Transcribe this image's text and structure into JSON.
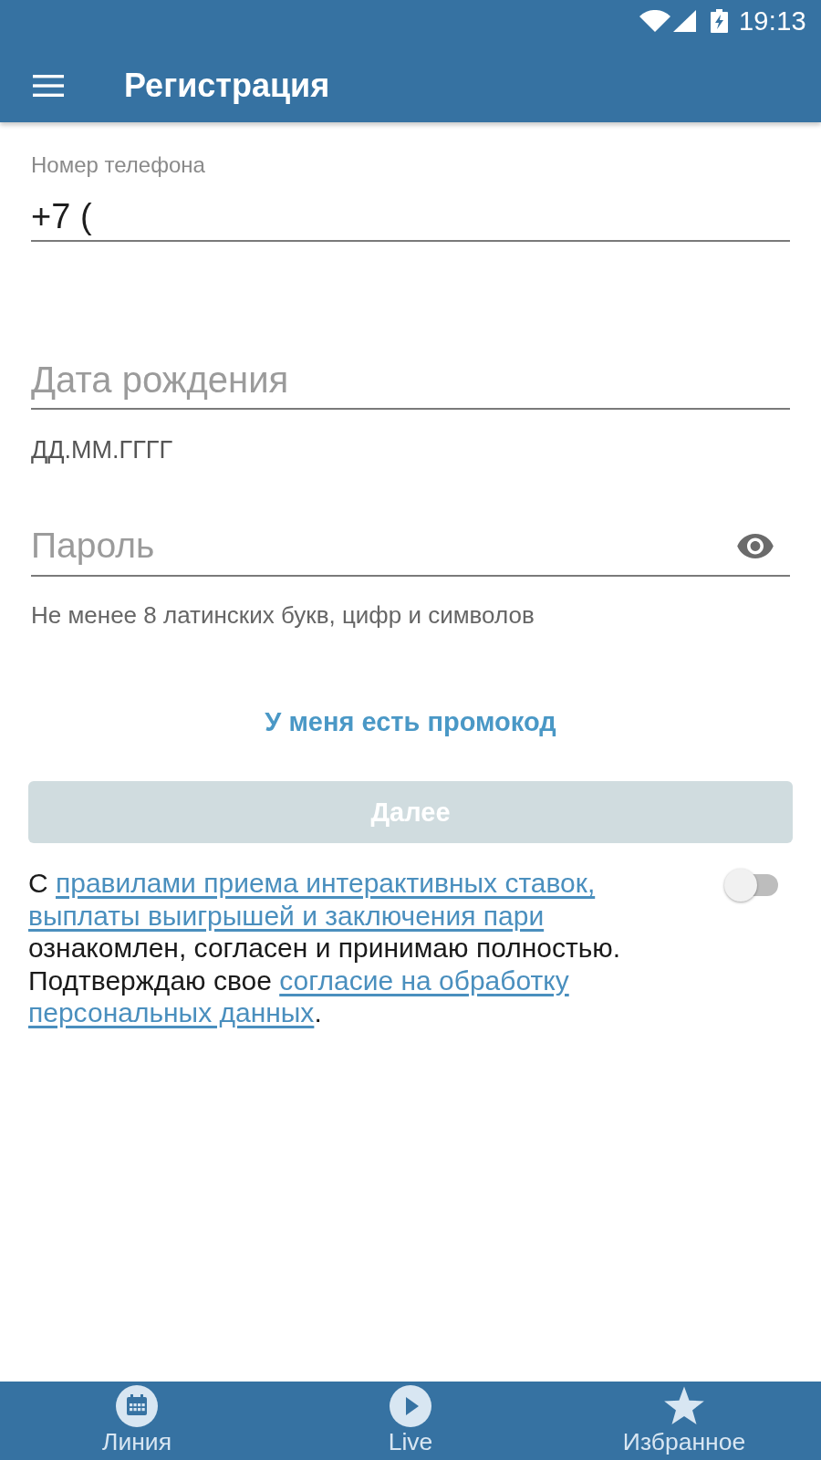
{
  "status_bar": {
    "time": "19:13"
  },
  "app_bar": {
    "title": "Регистрация"
  },
  "form": {
    "fields": [
      {
        "kind": "text",
        "label": "Номер телефона",
        "value": "+7 ("
      },
      {
        "kind": "text",
        "placeholder": "Дата рождения",
        "helper": "ДД.ММ.ГГГГ"
      },
      {
        "kind": "password",
        "placeholder": "Пароль",
        "helper": "Не менее 8 латинских букв, цифр и символов"
      }
    ],
    "promo_link": "У меня есть промокод",
    "next_button": {
      "label": "Далее",
      "disabled": true
    },
    "terms": {
      "parts": [
        {
          "kind": "text",
          "text": "С "
        },
        {
          "kind": "link",
          "text": "правилами приема интерактивных ставок,"
        },
        {
          "kind": "link",
          "text": "выплаты выигрышей и заключения пари"
        },
        {
          "kind": "text",
          "text": " ознакомлен, согласен и принимаю полностью. Подтверждаю свое "
        },
        {
          "kind": "link",
          "text": "согласие на обработку"
        },
        {
          "kind": "link",
          "text": "персональных данных"
        },
        {
          "kind": "text",
          "text": "."
        }
      ],
      "switch": {
        "on": false
      }
    }
  },
  "bottom_nav": [
    {
      "label": "Линия",
      "selected": false
    },
    {
      "label": "Live",
      "selected": false
    },
    {
      "label": "Избранное",
      "selected": false
    }
  ]
}
